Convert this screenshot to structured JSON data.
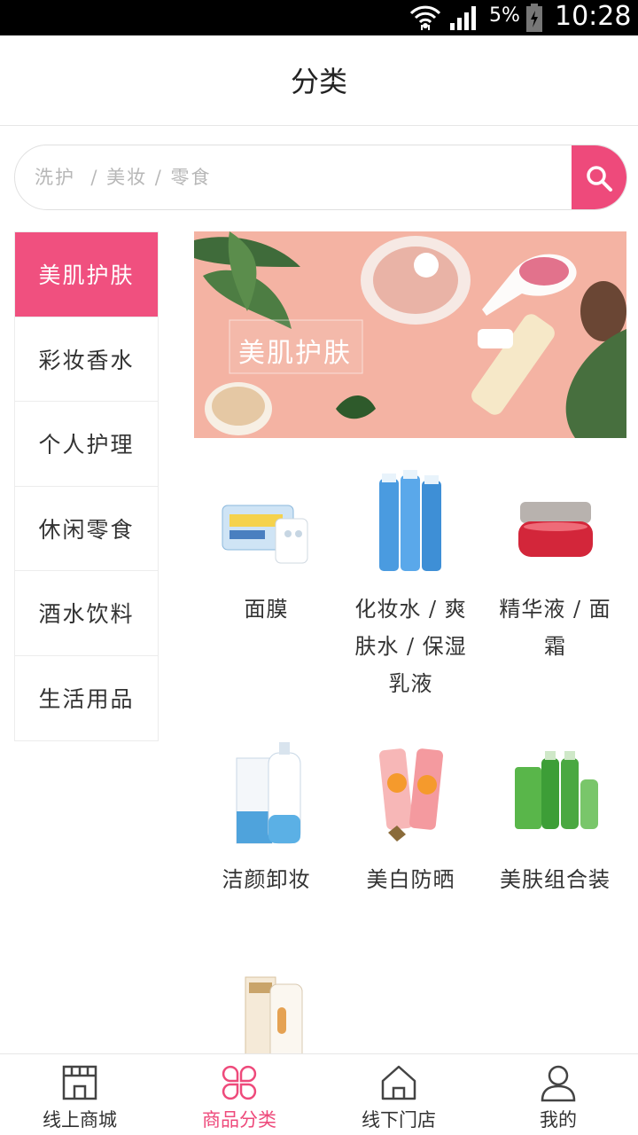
{
  "status_bar": {
    "battery": "5%",
    "time": "10:28"
  },
  "header": {
    "title": "分类"
  },
  "search": {
    "placeholder": "洗护  / 美妆 / 零食"
  },
  "sidebar": {
    "items": [
      {
        "label": "美肌护肤",
        "active": true
      },
      {
        "label": "彩妆香水",
        "active": false
      },
      {
        "label": "个人护理",
        "active": false
      },
      {
        "label": "休闲零食",
        "active": false
      },
      {
        "label": "酒水饮料",
        "active": false
      },
      {
        "label": "生活用品",
        "active": false
      }
    ]
  },
  "banner": {
    "text": "美肌护肤"
  },
  "products": [
    {
      "label": "面膜",
      "icon": "face-mask-package-image"
    },
    {
      "label": "化妆水 / 爽肤水 / 保湿乳液",
      "icon": "toner-bottles-image"
    },
    {
      "label": "精华液 / 面霜",
      "icon": "cream-jar-image"
    },
    {
      "label": "洁颜卸妆",
      "icon": "cleanser-bottle-image"
    },
    {
      "label": "美白防晒",
      "icon": "sunscreen-tubes-image"
    },
    {
      "label": "美肤组合装",
      "icon": "skincare-set-image"
    },
    {
      "label": "",
      "icon": "cleanser-tube-box-image"
    }
  ],
  "tabbar": {
    "items": [
      {
        "label": "线上商城",
        "icon": "store-icon",
        "active": false
      },
      {
        "label": "商品分类",
        "icon": "clover-grid-icon",
        "active": true
      },
      {
        "label": "线下门店",
        "icon": "house-icon",
        "active": false
      },
      {
        "label": "我的",
        "icon": "user-icon",
        "active": false
      }
    ]
  },
  "colors": {
    "accent": "#ee4a7b",
    "sidebar_active": "#f0507f",
    "status_bar": "#000000"
  }
}
